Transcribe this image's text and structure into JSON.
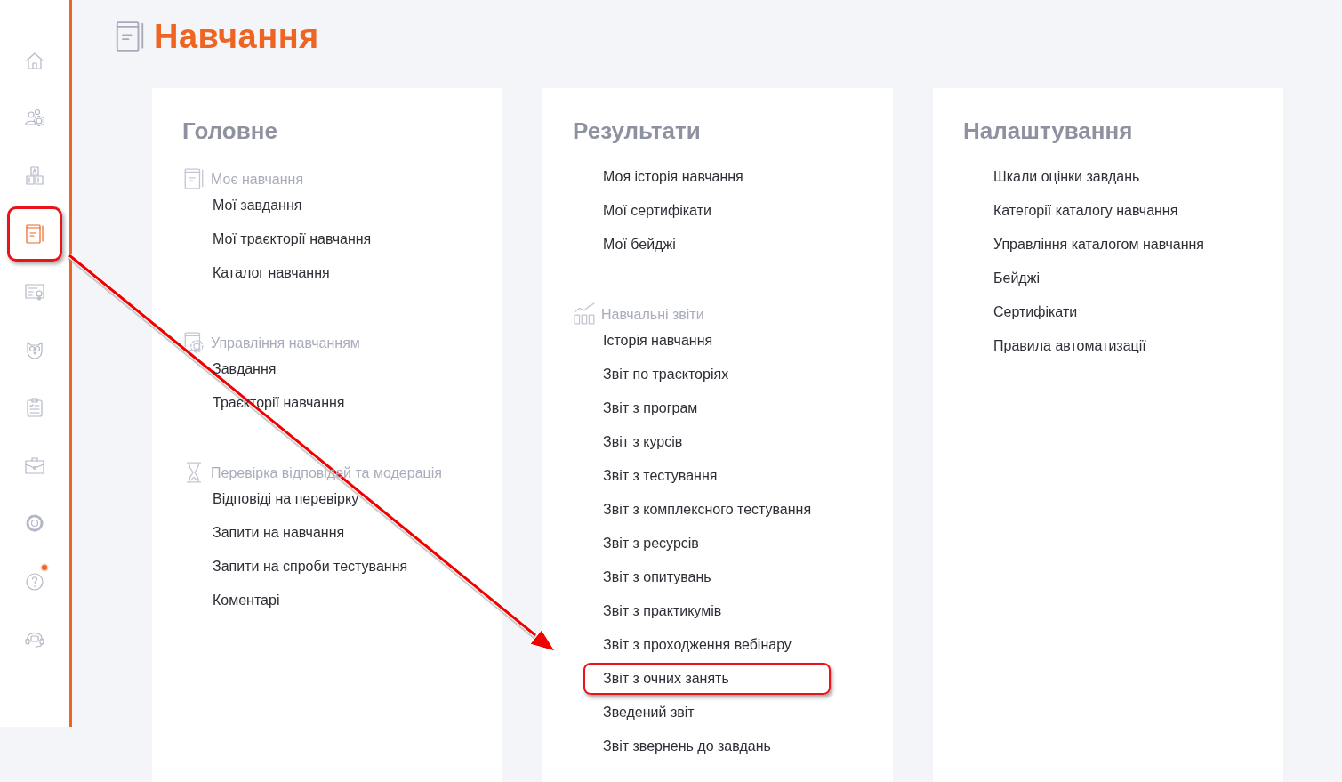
{
  "sidebar": {
    "items": [
      {
        "kind": "home",
        "selected": false,
        "annotated": false
      },
      {
        "kind": "people",
        "selected": false,
        "annotated": false
      },
      {
        "kind": "blocks",
        "selected": false,
        "annotated": false
      },
      {
        "kind": "notebook",
        "selected": true,
        "annotated": true
      },
      {
        "kind": "certificate",
        "selected": false,
        "annotated": false
      },
      {
        "kind": "owl",
        "selected": false,
        "annotated": false
      },
      {
        "kind": "clipboard",
        "selected": false,
        "annotated": false
      },
      {
        "kind": "briefcase",
        "selected": false,
        "annotated": false
      },
      {
        "kind": "settings",
        "selected": false,
        "annotated": false
      },
      {
        "kind": "help",
        "selected": false,
        "annotated": false,
        "badge": true
      },
      {
        "kind": "headset",
        "selected": false,
        "annotated": false
      }
    ]
  },
  "page": {
    "title": "Навчання"
  },
  "columns": [
    {
      "title": "Головне",
      "groups": [
        {
          "label": "Моє навчання",
          "items": [
            {
              "label": "Мої завдання",
              "annotated": false
            },
            {
              "label": "Мої траєкторії навчання",
              "annotated": false
            },
            {
              "label": "Каталог навчання",
              "annotated": false
            }
          ]
        },
        {
          "label": "Управління навчанням",
          "items": [
            {
              "label": "Завдання",
              "annotated": false
            },
            {
              "label": "Траєкторії навчання",
              "annotated": false
            }
          ]
        },
        {
          "label": "Перевірка відповідей та модерація",
          "items": [
            {
              "label": "Відповіді на перевірку",
              "annotated": false
            },
            {
              "label": "Запити на навчання",
              "annotated": false
            },
            {
              "label": "Запити на спроби тестування",
              "annotated": false
            },
            {
              "label": "Коментарі",
              "annotated": false
            }
          ]
        }
      ]
    },
    {
      "title": "Результати",
      "groups": [
        {
          "items": [
            {
              "label": "Моя історія навчання",
              "annotated": false
            },
            {
              "label": "Мої сертифікати",
              "annotated": false
            },
            {
              "label": "Мої бейджі",
              "annotated": false
            }
          ]
        },
        {
          "label": "Навчальні звіти",
          "items": [
            {
              "label": "Історія навчання",
              "annotated": false
            },
            {
              "label": "Звіт по траєкторіях",
              "annotated": false
            },
            {
              "label": "Звіт з програм",
              "annotated": false
            },
            {
              "label": "Звіт з курсів",
              "annotated": false
            },
            {
              "label": "Звіт з тестування",
              "annotated": false
            },
            {
              "label": "Звіт з комплексного тестування",
              "annotated": false
            },
            {
              "label": "Звіт з ресурсів",
              "annotated": false
            },
            {
              "label": "Звіт з опитувань",
              "annotated": false
            },
            {
              "label": "Звіт з практикумів",
              "annotated": false
            },
            {
              "label": "Звіт з проходження вебінару",
              "annotated": false
            },
            {
              "label": "Звіт з очних занять",
              "annotated": true
            },
            {
              "label": "Зведений звіт",
              "annotated": false
            },
            {
              "label": "Звіт звернень до завдань",
              "annotated": false
            }
          ]
        }
      ]
    },
    {
      "title": "Налаштування",
      "groups": [
        {
          "items": [
            {
              "label": "Шкали оцінки завдань",
              "annotated": false
            },
            {
              "label": "Категорії каталогу навчання",
              "annotated": false
            },
            {
              "label": "Управління каталогом навчання",
              "annotated": false
            },
            {
              "label": "Бейджі",
              "annotated": false
            },
            {
              "label": "Сертифікати",
              "annotated": false
            },
            {
              "label": "Правила автоматизації",
              "annotated": false
            }
          ]
        }
      ]
    }
  ],
  "annotation": {
    "arrow": true
  }
}
